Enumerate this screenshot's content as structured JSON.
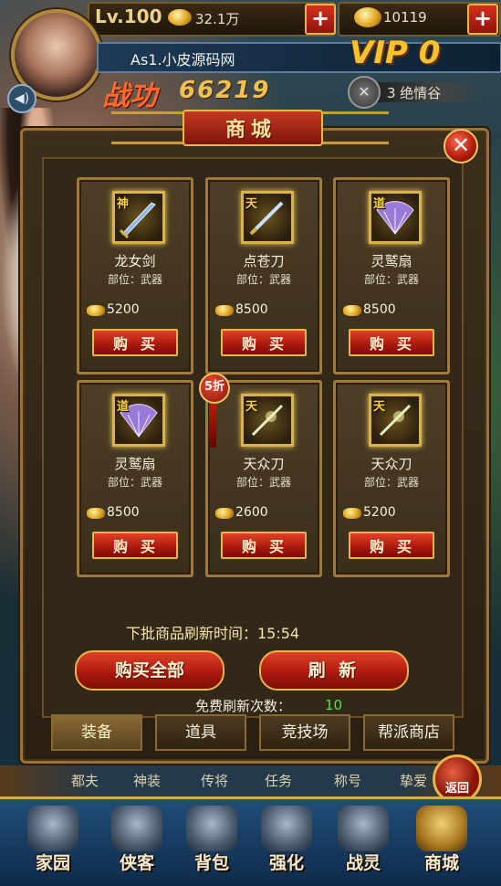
{
  "header": {
    "level": "Lv.100",
    "gold": "32.1万",
    "ingots": "10119",
    "player_name": "As1.小皮源码网",
    "vip": "VIP 0",
    "power_label": "战功",
    "power_value": "66219",
    "guild": "3 绝情谷"
  },
  "shop": {
    "title": "商城",
    "items": [
      {
        "tag": "神",
        "name": "龙女剑",
        "part": "部位：武器",
        "price": "5200",
        "buy": "购买",
        "icon": "sword-icon"
      },
      {
        "tag": "天",
        "name": "点苍刀",
        "part": "部位：武器",
        "price": "8500",
        "buy": "购买",
        "icon": "blade-icon"
      },
      {
        "tag": "道",
        "name": "灵鹫扇",
        "part": "部位：武器",
        "price": "8500",
        "buy": "购买",
        "icon": "fan-icon"
      },
      {
        "tag": "道",
        "name": "灵鹫扇",
        "part": "部位：武器",
        "price": "8500",
        "buy": "购买",
        "icon": "fan-icon"
      },
      {
        "tag": "天",
        "name": "天众刀",
        "part": "部位：武器",
        "price": "2600",
        "buy": "购买",
        "icon": "blade-icon"
      },
      {
        "tag": "天",
        "name": "天众刀",
        "part": "部位：武器",
        "price": "5200",
        "buy": "购买",
        "icon": "blade-icon"
      }
    ],
    "discount": "5折",
    "refresh_time_label": "下批商品刷新时间：15:54",
    "buy_all": "购买全部",
    "refresh": "刷  新",
    "free_refresh_label": "免费刷新次数：",
    "free_refresh_count": "10",
    "tabs": [
      "装备",
      "道具",
      "竞技场",
      "帮派商店"
    ]
  },
  "bottom": {
    "small_links": [
      "都夫",
      "神装",
      "传将",
      "任务",
      "称号",
      "挚爱"
    ],
    "dock": [
      "家园",
      "侠客",
      "背包",
      "强化",
      "战灵",
      "商城"
    ],
    "return": "返回"
  },
  "colors": {
    "accent_red": "#a8180c",
    "gold_border": "#e6b64c",
    "free_count": "#4ae84a"
  }
}
